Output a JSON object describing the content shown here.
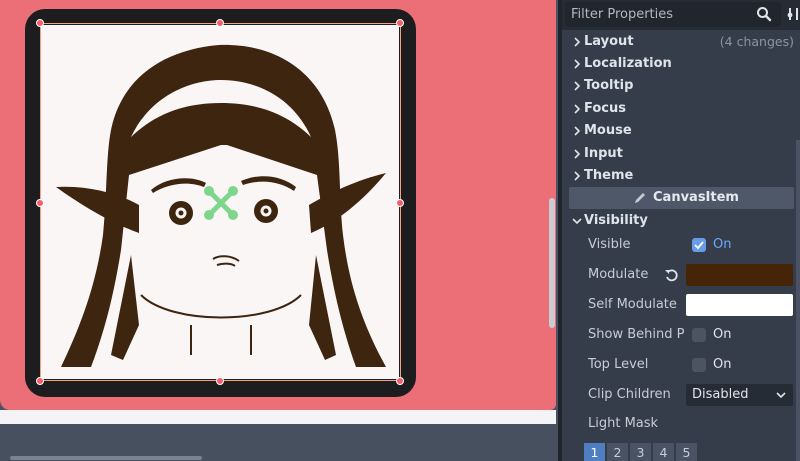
{
  "inspector": {
    "filter_placeholder": "Filter Properties",
    "groups": [
      {
        "label": "Layout",
        "changes": "(4 changes)"
      },
      {
        "label": "Localization",
        "changes": ""
      },
      {
        "label": "Tooltip",
        "changes": ""
      },
      {
        "label": "Focus",
        "changes": ""
      },
      {
        "label": "Mouse",
        "changes": ""
      },
      {
        "label": "Input",
        "changes": ""
      },
      {
        "label": "Theme",
        "changes": ""
      }
    ],
    "section_header": "CanvasItem",
    "subgroup": "Visibility",
    "properties": {
      "visible": {
        "name": "Visible",
        "checked": true,
        "value": "On"
      },
      "modulate": {
        "name": "Modulate",
        "color": "#452408"
      },
      "self_modulate": {
        "name": "Self Modulate",
        "color": "#ffffff"
      },
      "show_behind": {
        "name": "Show Behind P",
        "checked": false,
        "value": "On"
      },
      "top_level": {
        "name": "Top Level",
        "checked": false,
        "value": "On"
      },
      "clip_children": {
        "name": "Clip Children",
        "value": "Disabled"
      },
      "light_mask": {
        "name": "Light Mask",
        "layers": [
          "1",
          "2",
          "3",
          "4",
          "5"
        ],
        "active_layer": "1"
      }
    },
    "icons": [
      "search-icon",
      "tools-icon",
      "chevron-right-icon",
      "chevron-down-icon",
      "pencil-icon",
      "revert-icon"
    ]
  },
  "viewport": {
    "canvas_color": "#ec6e77",
    "panel_color": "#1d1d20",
    "artwork": "elf-girl-portrait",
    "pivot_color": "#7ed68d"
  }
}
